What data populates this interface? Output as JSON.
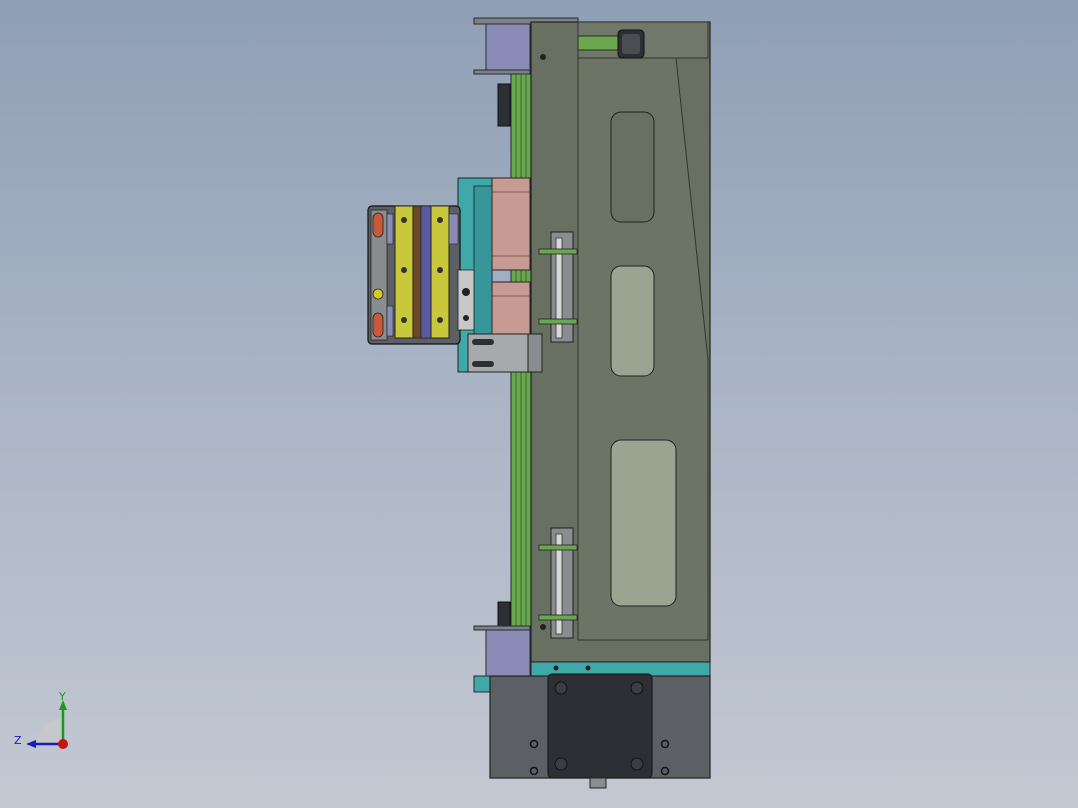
{
  "view": {
    "colors": {
      "bg_top": "#8f9fb6",
      "bg_bottom": "#c3c9d3",
      "housing": "#687062",
      "housing_dark": "#565c52",
      "window": "#9ba391",
      "base": "#5c6064",
      "plate_dark": "#2c3034",
      "teal": "#3fa8a8",
      "belt": "#6aa84f",
      "lavender": "#8b8bb8",
      "pink": "#c89a94",
      "yellow": "#c8c83a",
      "gray": "#8a8d8f"
    }
  },
  "triad": {
    "y_label": "Y",
    "z_label": "Z",
    "y_color": "#1a9a1a",
    "z_color": "#1a1ab8",
    "x_color": "#cc1111"
  }
}
